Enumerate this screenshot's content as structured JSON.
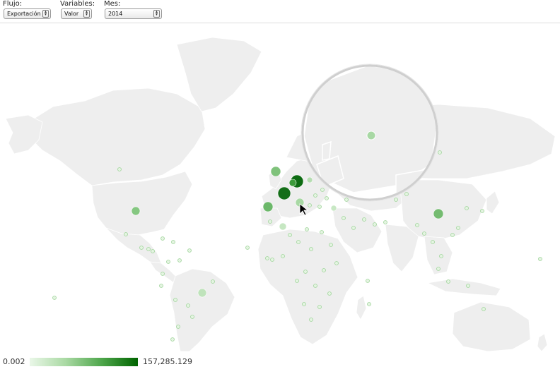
{
  "controls": {
    "flujo": {
      "label": "Flujo:",
      "value": "Exportación"
    },
    "variables": {
      "label": "Variables:",
      "value": "Valor"
    },
    "mes": {
      "label": "Mes:",
      "value": "2014"
    }
  },
  "legend": {
    "min": "0.002",
    "max": "157,285.129",
    "color_low": "#eaf7e8",
    "color_high": "#006400"
  },
  "colors": {
    "land": "#eeeeee",
    "border": "#ffffff",
    "water": "#ffffff"
  }
}
